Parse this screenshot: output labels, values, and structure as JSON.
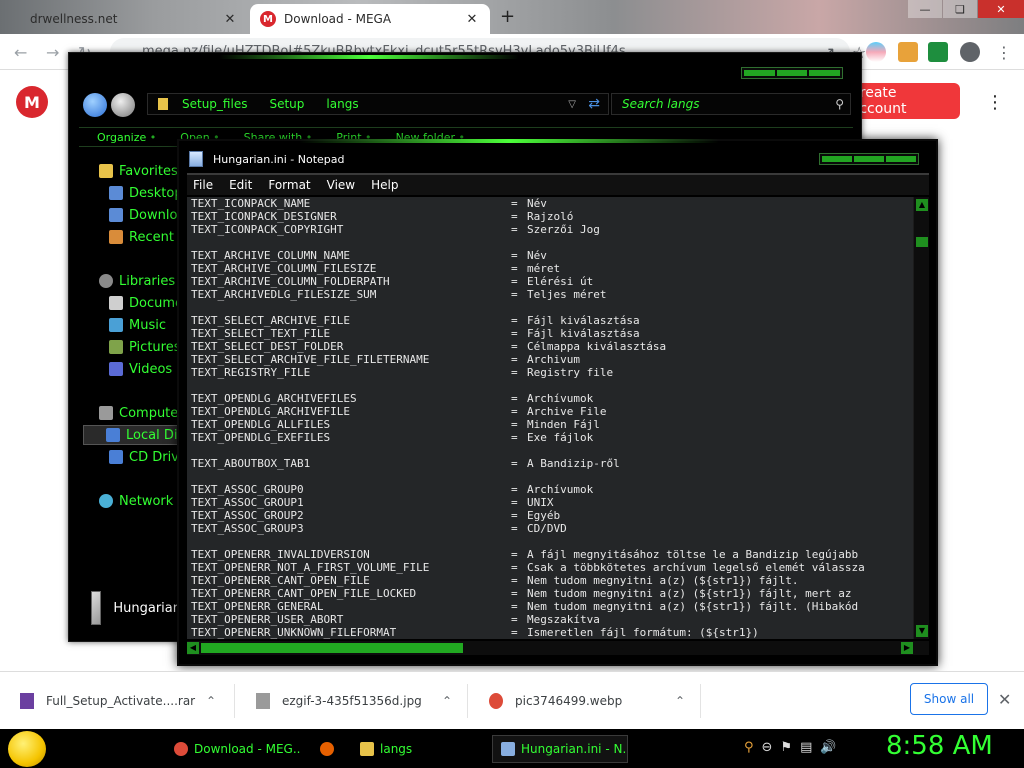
{
  "browser": {
    "tabs": [
      {
        "title": "drwellness.net",
        "close": "✕"
      },
      {
        "title": "Download - MEGA",
        "close": "✕"
      }
    ],
    "new_tab": "+",
    "url": "mega.nz/file/uHZTDBoI#5ZkuBRbvtxFkxi_dcut5r55tRsvH3vLado5y3BiUf4s"
  },
  "mega": {
    "logo": "M",
    "create_account": "Create Account"
  },
  "explorer": {
    "breadcrumbs": [
      "Setup_files",
      "Setup",
      "langs"
    ],
    "search_placeholder": "Search langs",
    "commands": [
      "Organize",
      "Open",
      "Share with",
      "Print",
      "New folder"
    ],
    "sidebar": [
      {
        "label": "Favorites",
        "color": "#e8c34a"
      },
      {
        "label": "Desktop",
        "color": "#5b8bd6"
      },
      {
        "label": "Downloads",
        "color": "#5b8bd6"
      },
      {
        "label": "Recent Places",
        "color": "#d98c3a"
      },
      {
        "label": "Libraries",
        "color": "#8a8a8a"
      },
      {
        "label": "Documents",
        "color": "#cfcfcf"
      },
      {
        "label": "Music",
        "color": "#4aa0d6"
      },
      {
        "label": "Pictures",
        "color": "#7fa34a"
      },
      {
        "label": "Videos",
        "color": "#5b6bd6"
      },
      {
        "label": "Computer",
        "color": "#9a9a9a"
      },
      {
        "label": "Local Disk",
        "color": "#4a7fd6"
      },
      {
        "label": "CD Drive",
        "color": "#4a7fd6"
      },
      {
        "label": "Network",
        "color": "#4ab0d6"
      }
    ],
    "preview_label": "Hungarian"
  },
  "notepad": {
    "title": "Hungarian.ini - Notepad",
    "menu": [
      "File",
      "Edit",
      "Format",
      "View",
      "Help"
    ],
    "lines": [
      {
        "k": "TEXT_ICONPACK_NAME",
        "v": "Név"
      },
      {
        "k": "TEXT_ICONPACK_DESIGNER",
        "v": "Rajzoló"
      },
      {
        "k": "TEXT_ICONPACK_COPYRIGHT",
        "v": "Szerzői Jog"
      },
      {
        "k": "",
        "v": ""
      },
      {
        "k": "TEXT_ARCHIVE_COLUMN_NAME",
        "v": "Név"
      },
      {
        "k": "TEXT_ARCHIVE_COLUMN_FILESIZE",
        "v": "méret"
      },
      {
        "k": "TEXT_ARCHIVE_COLUMN_FOLDERPATH",
        "v": "Elérési út"
      },
      {
        "k": "TEXT_ARCHIVEDLG_FILESIZE_SUM",
        "v": "Teljes méret"
      },
      {
        "k": "",
        "v": ""
      },
      {
        "k": "TEXT_SELECT_ARCHIVE_FILE",
        "v": "Fájl kiválasztása"
      },
      {
        "k": "TEXT_SELECT_TEXT_FILE",
        "v": "Fájl kiválasztása"
      },
      {
        "k": "TEXT_SELECT_DEST_FOLDER",
        "v": "Célmappa kiválasztása"
      },
      {
        "k": "TEXT_SELECT_ARCHIVE_FILE_FILETERNAME",
        "v": "Archivum"
      },
      {
        "k": "TEXT_REGISTRY_FILE",
        "v": "Registry file"
      },
      {
        "k": "",
        "v": ""
      },
      {
        "k": "TEXT_OPENDLG_ARCHIVEFILES",
        "v": "Archívumok"
      },
      {
        "k": "TEXT_OPENDLG_ARCHIVEFILE",
        "v": "Archive File"
      },
      {
        "k": "TEXT_OPENDLG_ALLFILES",
        "v": "Minden Fájl"
      },
      {
        "k": "TEXT_OPENDLG_EXEFILES",
        "v": "Exe fájlok"
      },
      {
        "k": "",
        "v": ""
      },
      {
        "k": "TEXT_ABOUTBOX_TAB1",
        "v": "A Bandizip-ről"
      },
      {
        "k": "",
        "v": ""
      },
      {
        "k": "TEXT_ASSOC_GROUP0",
        "v": "Archívumok"
      },
      {
        "k": "TEXT_ASSOC_GROUP1",
        "v": "UNIX"
      },
      {
        "k": "TEXT_ASSOC_GROUP2",
        "v": "Egyéb"
      },
      {
        "k": "TEXT_ASSOC_GROUP3",
        "v": "CD/DVD"
      },
      {
        "k": "",
        "v": ""
      },
      {
        "k": "TEXT_OPENERR_INVALIDVERSION",
        "v": "A fájl megnyitásához töltse le a Bandizip legújabb"
      },
      {
        "k": "TEXT_OPENERR_NOT_A_FIRST_VOLUME_FILE",
        "v": "Csak a többkötetes archívum legelső elemét válassza"
      },
      {
        "k": "TEXT_OPENERR_CANT_OPEN_FILE",
        "v": "Nem tudom megnyitni a(z) (${str1}) fájlt."
      },
      {
        "k": "TEXT_OPENERR_CANT_OPEN_FILE_LOCKED",
        "v": "Nem tudom megnyitni a(z) (${str1}) fájlt, mert az"
      },
      {
        "k": "TEXT_OPENERR_GENERAL",
        "v": "Nem tudom megnyitni a(z) (${str1}) fájlt. (Hibakód"
      },
      {
        "k": "TEXT_OPENERR_USER_ABORT",
        "v": "Megszakítva"
      },
      {
        "k": "TEXT_OPENERR_UNKNOWN_FILEFORMAT",
        "v": "Ismeretlen fájl formátum: (${str1})"
      }
    ]
  },
  "downloads": {
    "items": [
      {
        "name": "Full_Setup_Activate....rar",
        "color": "#6b3fa0"
      },
      {
        "name": "ezgif-3-435f51356d.jpg",
        "color": "#9a9a9a"
      },
      {
        "name": "pic3746499.webp",
        "color": "#dd4b39"
      }
    ],
    "show_all": "Show all"
  },
  "taskbar": {
    "tasks": [
      {
        "label": "Download - MEG...",
        "color": "#dd4b39"
      },
      {
        "label": "",
        "color": "#e66000"
      },
      {
        "label": "langs",
        "color": "#e8c34a"
      },
      {
        "label": "Hungarian.ini - N...",
        "color": "#88aee0"
      }
    ],
    "clock": "8:58 AM"
  },
  "colors": {
    "accent_green": "#33ff33",
    "mega_red": "#d9272e"
  }
}
